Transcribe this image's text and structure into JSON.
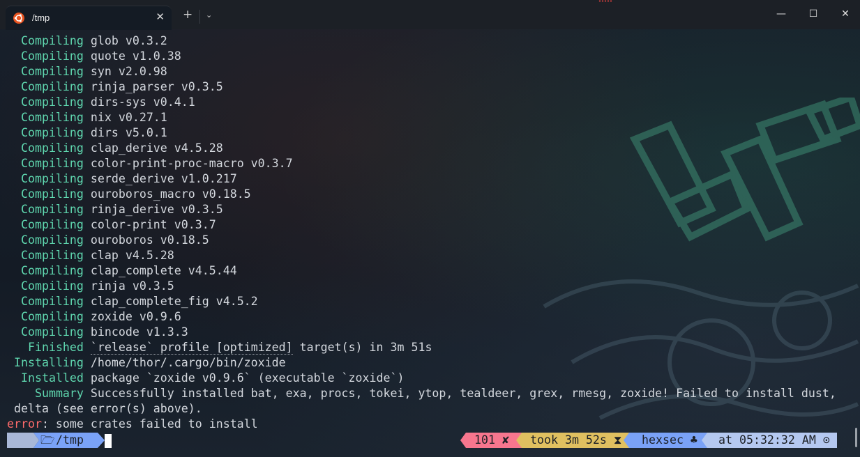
{
  "window": {
    "tab_title": "/tmp",
    "tab_close": "✕",
    "new_tab": "+",
    "dropdown": "⌄",
    "minimize": "—",
    "maximize": "☐",
    "close": "✕"
  },
  "terminal": {
    "lines": [
      {
        "pad": "  ",
        "kw": "Compiling",
        "text": " glob v0.3.2"
      },
      {
        "pad": "  ",
        "kw": "Compiling",
        "text": " quote v1.0.38"
      },
      {
        "pad": "  ",
        "kw": "Compiling",
        "text": " syn v2.0.98"
      },
      {
        "pad": "  ",
        "kw": "Compiling",
        "text": " rinja_parser v0.3.5"
      },
      {
        "pad": "  ",
        "kw": "Compiling",
        "text": " dirs-sys v0.4.1"
      },
      {
        "pad": "  ",
        "kw": "Compiling",
        "text": " nix v0.27.1"
      },
      {
        "pad": "  ",
        "kw": "Compiling",
        "text": " dirs v5.0.1"
      },
      {
        "pad": "  ",
        "kw": "Compiling",
        "text": " clap_derive v4.5.28"
      },
      {
        "pad": "  ",
        "kw": "Compiling",
        "text": " color-print-proc-macro v0.3.7"
      },
      {
        "pad": "  ",
        "kw": "Compiling",
        "text": " serde_derive v1.0.217"
      },
      {
        "pad": "  ",
        "kw": "Compiling",
        "text": " ouroboros_macro v0.18.5"
      },
      {
        "pad": "  ",
        "kw": "Compiling",
        "text": " rinja_derive v0.3.5"
      },
      {
        "pad": "  ",
        "kw": "Compiling",
        "text": " color-print v0.3.7"
      },
      {
        "pad": "  ",
        "kw": "Compiling",
        "text": " ouroboros v0.18.5"
      },
      {
        "pad": "  ",
        "kw": "Compiling",
        "text": " clap v4.5.28"
      },
      {
        "pad": "  ",
        "kw": "Compiling",
        "text": " clap_complete v4.5.44"
      },
      {
        "pad": "  ",
        "kw": "Compiling",
        "text": " rinja v0.3.5"
      },
      {
        "pad": "  ",
        "kw": "Compiling",
        "text": " clap_complete_fig v4.5.2"
      },
      {
        "pad": "  ",
        "kw": "Compiling",
        "text": " zoxide v0.9.6"
      },
      {
        "pad": "  ",
        "kw": "Compiling",
        "text": " bincode v1.3.3"
      }
    ],
    "finished": {
      "pad": "   ",
      "kw": "Finished",
      "dotted": "`release` profile [optimized]",
      "text": " target(s) in 3m 51s"
    },
    "installing": {
      "pad": " ",
      "kw": "Installing",
      "text": " /home/thor/.cargo/bin/zoxide"
    },
    "installed": {
      "pad": "  ",
      "kw": "Installed",
      "text": " package `zoxide v0.9.6` (executable `zoxide`)"
    },
    "summary": {
      "pad": "    ",
      "kw": "Summary",
      "text": " Successfully installed bat, exa, procs, tokei, ytop, tealdeer, grex, rmesg, zoxide! Failed to install dust,"
    },
    "summary_cont": " delta (see error(s) above).",
    "error": {
      "kw": "error",
      "text": ": some crates failed to install"
    }
  },
  "prompt": {
    "os_icon": "",
    "dir_icon": "🗁",
    "dir": "/tmp",
    "status_code": "101 ✘",
    "took": "took 3m 52s ⧗",
    "user": "hexsec ♣",
    "time": "at 05:32:32 AM ⊙"
  },
  "colors": {
    "green": "#5fd7af",
    "error": "#ff6b6b",
    "prompt_blue": "#7aa2f7",
    "status_red": "#f7768e",
    "took_yellow": "#e0c060",
    "user_blue": "#7aa2f7",
    "time_blue": "#b4c8f0"
  }
}
